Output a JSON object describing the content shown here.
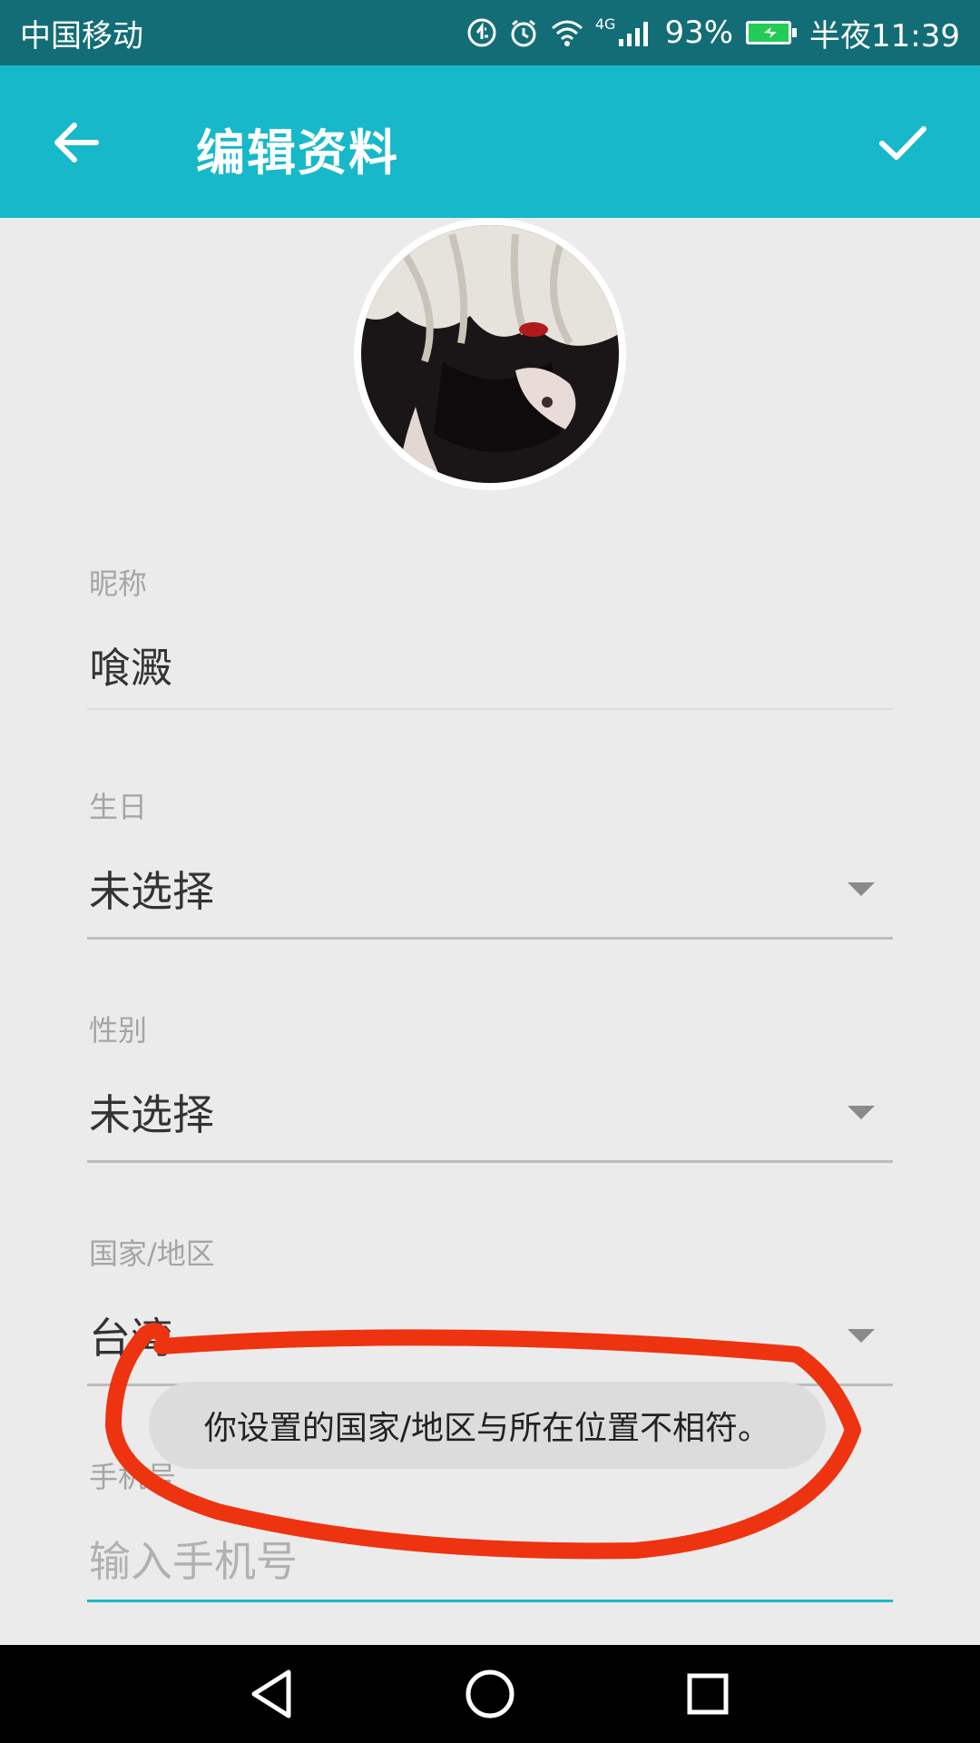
{
  "status_bar": {
    "carrier": "中国移动",
    "network": "4G",
    "battery": "93%",
    "time": "半夜11:39",
    "icons": [
      "data-saver-icon",
      "alarm-icon",
      "wifi-icon",
      "signal-icon",
      "battery-charging-icon"
    ],
    "battery_color": "#22cc55"
  },
  "app_bar": {
    "title": "编辑资料",
    "back_icon": "arrow-left-icon",
    "confirm_icon": "checkmark-icon",
    "color": "#17b8c9"
  },
  "form": {
    "nickname": {
      "label": "昵称",
      "value": "喰澱"
    },
    "birthday": {
      "label": "生日",
      "value": "未选择"
    },
    "gender": {
      "label": "性别",
      "value": "未选择"
    },
    "region": {
      "label": "国家/地区",
      "value": "台湾"
    },
    "phone": {
      "label": "手机号",
      "placeholder": "输入手机号"
    }
  },
  "toast": {
    "message": "你设置的国家/地区与所在位置不相符。"
  },
  "annotation": {
    "color": "#ee3311",
    "shape": "hand-drawn ellipse around toast"
  },
  "nav_bar": {
    "icons": [
      "back-triangle-icon",
      "home-circle-icon",
      "recents-square-icon"
    ]
  }
}
